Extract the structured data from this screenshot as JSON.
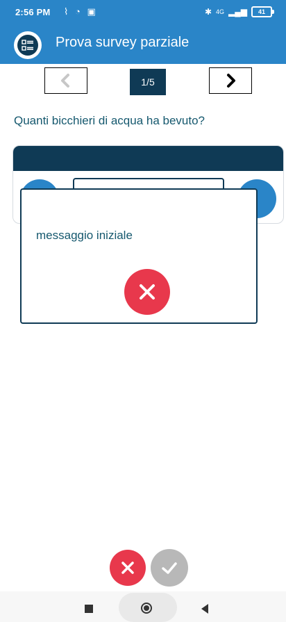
{
  "status_bar": {
    "time": "2:56 PM",
    "icons_left": [
      "wifi-off-icon",
      "alarm-icon",
      "notification-icon"
    ],
    "icons_right": [
      "bluetooth-icon",
      "network-4g-icon",
      "signal-icon",
      "battery-icon"
    ],
    "network_label": "4G",
    "battery_level": "41"
  },
  "app_bar": {
    "title": "Prova survey parziale",
    "logo_icon": "checklist-icon"
  },
  "pager": {
    "prev_icon": "chevron-left-icon",
    "next_icon": "chevron-right-icon",
    "indicator": "1/5",
    "prev_enabled": false,
    "next_enabled": true
  },
  "question": {
    "text": "Quanti bicchieri di acqua ha bevuto?"
  },
  "dialog": {
    "message": "messaggio iniziale",
    "close_icon": "close-icon"
  },
  "bottom_actions": {
    "cancel_icon": "close-icon",
    "confirm_icon": "check-icon"
  },
  "nav_bar": {
    "recent_icon": "recent-apps-icon",
    "home_icon": "home-icon",
    "back_icon": "back-icon"
  },
  "colors": {
    "primary": "#2a85c8",
    "dark_navy": "#0f3a55",
    "text_teal": "#15586e",
    "danger": "#e8384c",
    "disabled": "#b8b8b8"
  }
}
